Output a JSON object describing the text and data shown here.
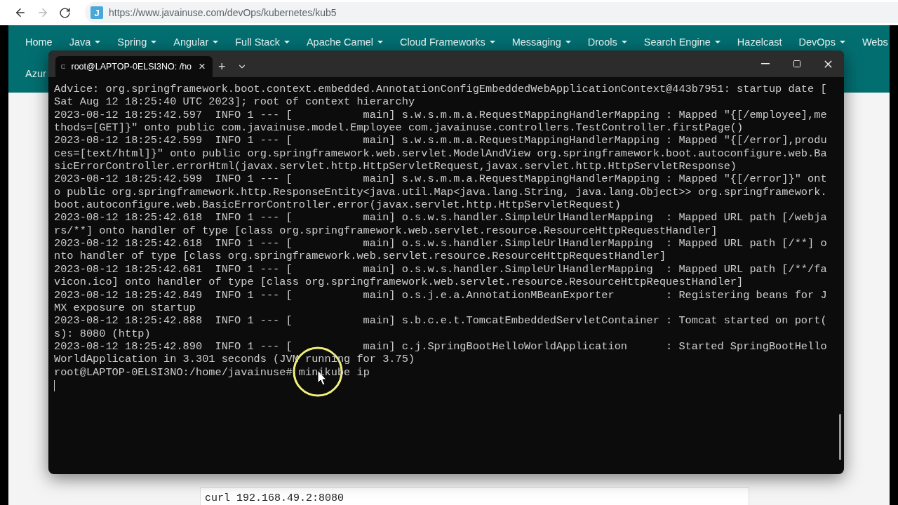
{
  "browser": {
    "favicon": "J",
    "url": "https://www.javainuse.com/devOps/kubernetes/kub5"
  },
  "nav": {
    "rows": [
      [
        {
          "label": "Home",
          "dropdown": false
        },
        {
          "label": "Java",
          "dropdown": true
        },
        {
          "label": "Spring",
          "dropdown": true
        },
        {
          "label": "Angular",
          "dropdown": true
        },
        {
          "label": "Full Stack",
          "dropdown": true
        },
        {
          "label": "Apache Camel",
          "dropdown": true
        },
        {
          "label": "Cloud Frameworks",
          "dropdown": true
        },
        {
          "label": "Messaging",
          "dropdown": true
        },
        {
          "label": "Drools",
          "dropdown": true
        },
        {
          "label": "Search Engine",
          "dropdown": true
        },
        {
          "label": "Hazelcast",
          "dropdown": false
        },
        {
          "label": "DevOps",
          "dropdown": true
        },
        {
          "label": "Webs",
          "dropdown": false
        }
      ],
      [
        {
          "label": "Azur",
          "dropdown": false
        }
      ]
    ]
  },
  "terminal": {
    "tab": {
      "title": "root@LAPTOP-0ELSI3NO: /ho",
      "close": "×"
    },
    "new_tab": "+",
    "lines": [
      "Advice: org.springframework.boot.context.embedded.AnnotationConfigEmbeddedWebApplicationContext@443b7951: startup date [",
      "Sat Aug 12 18:25:40 UTC 2023]; root of context hierarchy",
      "2023-08-12 18:25:42.597  INFO 1 --- [           main] s.w.s.m.m.a.RequestMappingHandlerMapping : Mapped \"{[/employee],me",
      "thods=[GET]}\" onto public com.javainuse.model.Employee com.javainuse.controllers.TestController.firstPage()",
      "2023-08-12 18:25:42.599  INFO 1 --- [           main] s.w.s.m.m.a.RequestMappingHandlerMapping : Mapped \"{[/error],produ",
      "ces=[text/html]}\" onto public org.springframework.web.servlet.ModelAndView org.springframework.boot.autoconfigure.web.Ba",
      "sicErrorController.errorHtml(javax.servlet.http.HttpServletRequest,javax.servlet.http.HttpServletResponse)",
      "2023-08-12 18:25:42.599  INFO 1 --- [           main] s.w.s.m.m.a.RequestMappingHandlerMapping : Mapped \"{[/error]}\" ont",
      "o public org.springframework.http.ResponseEntity<java.util.Map<java.lang.String, java.lang.Object>> org.springframework.",
      "boot.autoconfigure.web.BasicErrorController.error(javax.servlet.http.HttpServletRequest)",
      "2023-08-12 18:25:42.618  INFO 1 --- [           main] o.s.w.s.handler.SimpleUrlHandlerMapping  : Mapped URL path [/webja",
      "rs/**] onto handler of type [class org.springframework.web.servlet.resource.ResourceHttpRequestHandler]",
      "2023-08-12 18:25:42.618  INFO 1 --- [           main] o.s.w.s.handler.SimpleUrlHandlerMapping  : Mapped URL path [/**] o",
      "nto handler of type [class org.springframework.web.servlet.resource.ResourceHttpRequestHandler]",
      "2023-08-12 18:25:42.681  INFO 1 --- [           main] o.s.w.s.handler.SimpleUrlHandlerMapping  : Mapped URL path [/**/fa",
      "vicon.ico] onto handler of type [class org.springframework.web.servlet.resource.ResourceHttpRequestHandler]",
      "2023-08-12 18:25:42.849  INFO 1 --- [           main] o.s.j.e.a.AnnotationMBeanExporter        : Registering beans for J",
      "MX exposure on startup",
      "2023-08-12 18:25:42.888  INFO 1 --- [           main] s.b.c.e.t.TomcatEmbeddedServletContainer : Tomcat started on port(",
      "s): 8080 (http)",
      "2023-08-12 18:25:42.890  INFO 1 --- [           main] c.j.SpringBootHelloWorldApplication      : Started SpringBootHello",
      "WorldApplication in 3.301 seconds (JVM running for 3.75)"
    ],
    "prompt": "root@LAPTOP-0ELSI3NO:/home/javainuse#",
    "command": "minikube ip"
  },
  "code_block": "curl 192.168.49.2:8080"
}
